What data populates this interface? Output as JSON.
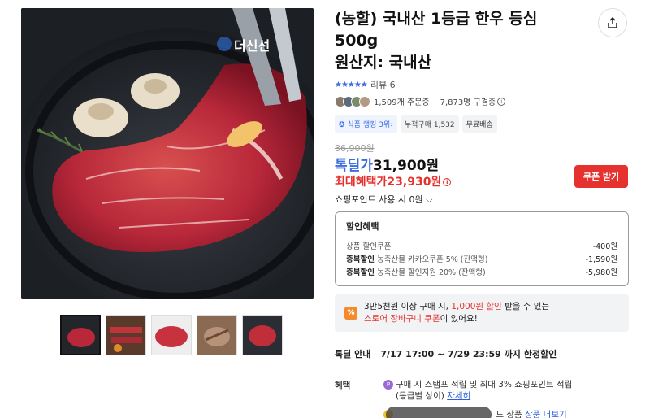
{
  "product": {
    "title_line1": "(농할) 국내산 1등급 한우 등심",
    "title_line2": "500g",
    "origin": "원산지: 국내산",
    "stars": "★★★★★",
    "review_label": "리뷰 6",
    "orders": "1,509개 주문중",
    "subscribers": "7,873명 구경중",
    "info_glyph": "i",
    "rank_badge": "식품 랭킹 3위",
    "rank_caret": "›",
    "cumulative_badge": "누적구매 1,532",
    "shipping_badge": "무료배송",
    "brand_watermark": "더신선"
  },
  "price": {
    "original": "36,900원",
    "deal_label": "톡딜가",
    "deal_value": "31,900원",
    "max_benefit_label": "최대혜택가",
    "max_benefit_value": "23,930원",
    "coupon_button": "쿠폰 받기",
    "points_label": "쇼핑포인트 사용 시",
    "points_value": "0원"
  },
  "discount": {
    "title": "할인혜택",
    "rows": [
      {
        "label_bold": "",
        "label": "상품 할인쿠폰",
        "amount": "-400원"
      },
      {
        "label_bold": "중복할인",
        "label": "농축산물 카카오쿠폰 5% (잔액형)",
        "amount": "-1,590원"
      },
      {
        "label_bold": "중복할인",
        "label": "농축산물 할인지원 20% (잔액형)",
        "amount": "-5,980원"
      }
    ]
  },
  "promo": {
    "icon": "%",
    "line1_pre": "3만5천원 이상 구매 시, ",
    "line1_hl": "1,000원 할인",
    "line1_post": " 받을 수 있는",
    "line2_hl": "스토어 장바구니 쿠폰",
    "line2_post": "이 있어요!"
  },
  "deal_info": {
    "label": "톡딜 안내",
    "value": "7/17 17:00 ~ 7/29 23:59 까지 한정할인"
  },
  "benefit": {
    "label": "혜택",
    "icon_p": "P",
    "line1": "구매 시 스탬프 적립 및 최대 3% 쇼핑포인트 적립",
    "line1b": "(등급별 상이)",
    "line1_link": "자세히",
    "line2_text": "드 상품",
    "line2_link": "상품 더보기"
  },
  "colors": {
    "accent_blue": "#3b6de0",
    "accent_red": "#e5322e",
    "promo_orange": "#f48a2c"
  }
}
